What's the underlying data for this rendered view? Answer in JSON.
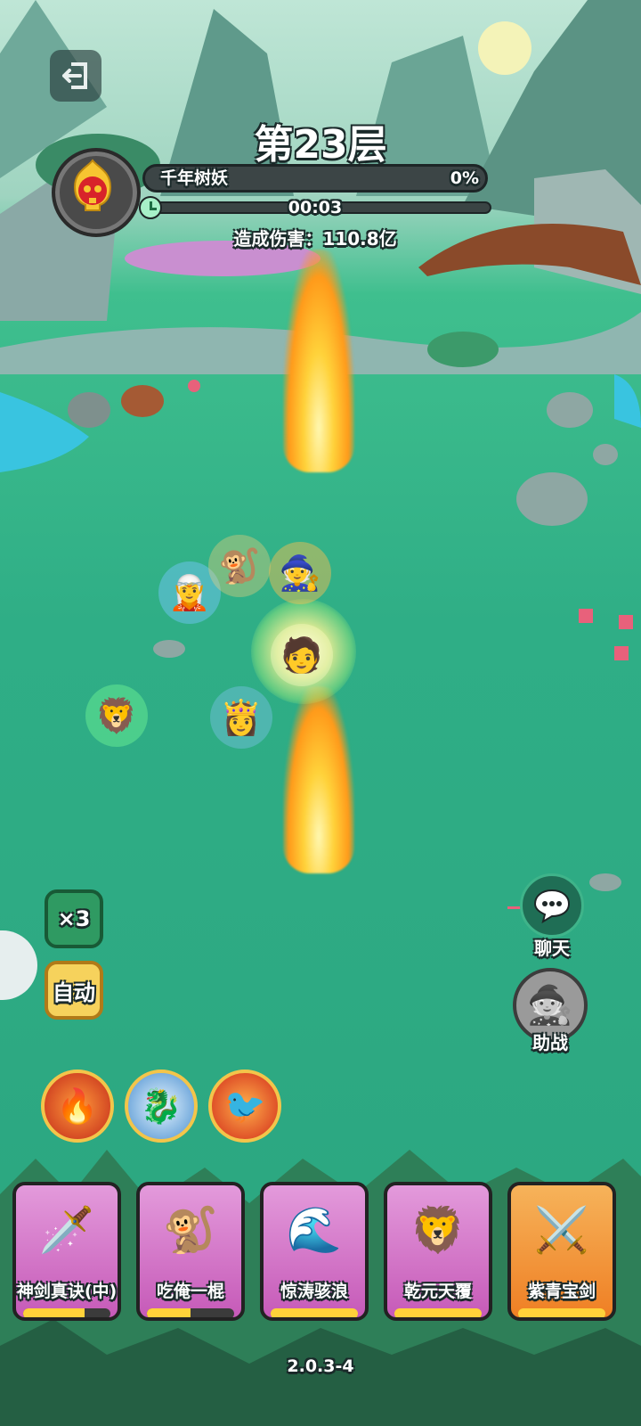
{
  "hud": {
    "floor_title": "第23层",
    "boss_name": "千年树妖",
    "boss_hp_percent_text": "0%",
    "timer": "00:03",
    "damage_text": "造成伤害：110.8亿"
  },
  "controls": {
    "speed_label": "×3",
    "auto_label": "自动",
    "chat_label": "聊天",
    "assist_label": "助战"
  },
  "skills": [
    {
      "icon": "fire-slash-icon"
    },
    {
      "icon": "dragon-icon"
    },
    {
      "icon": "phoenix-icon"
    }
  ],
  "cards": [
    {
      "name": "神剑真诀(中)",
      "progress": 0.7,
      "theme": "purple"
    },
    {
      "name": "吃俺一棍",
      "progress": 0.5,
      "theme": "purple"
    },
    {
      "name": "惊涛骇浪",
      "progress": 1.0,
      "theme": "purple"
    },
    {
      "name": "乾元天覆",
      "progress": 1.0,
      "theme": "purple"
    },
    {
      "name": "紫青宝剑",
      "progress": 1.0,
      "theme": "orange"
    }
  ],
  "version": "2.0.3-4",
  "colors": {
    "grass": "#2fae86",
    "gold": "#f3c54a",
    "card_purple": "#d867c8",
    "card_orange": "#f28a2a",
    "hp_fill": "#ffd23a"
  }
}
